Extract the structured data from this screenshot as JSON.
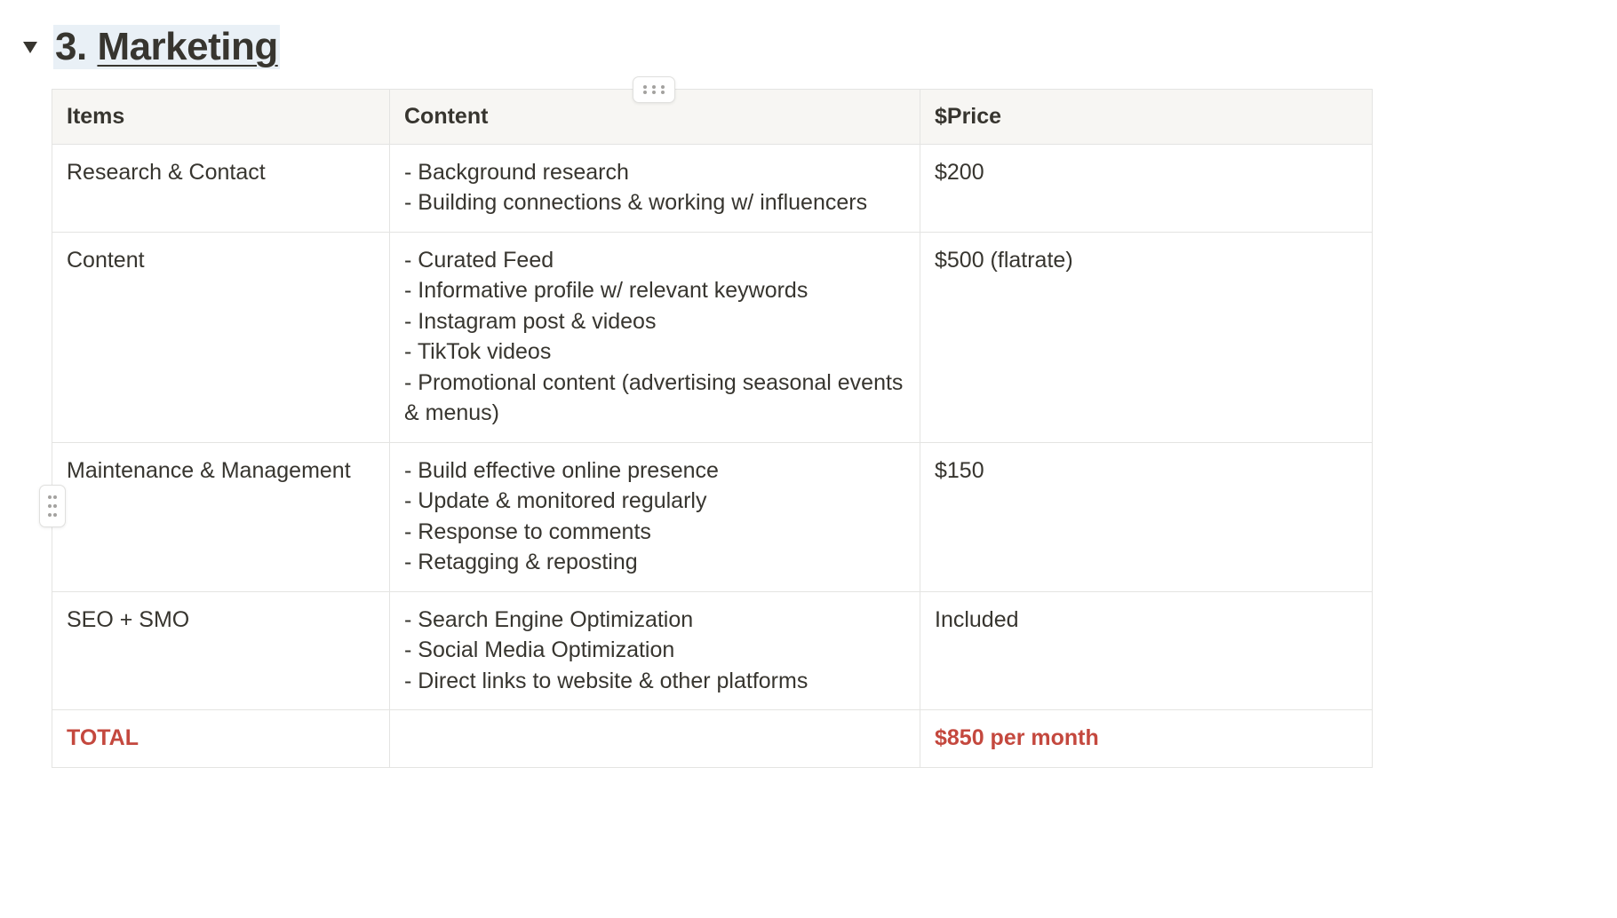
{
  "heading": {
    "number": "3.",
    "title": "Marketing"
  },
  "icons": {
    "toggle": "triangle-down-icon",
    "column_handle": "drag-dots-horizontal-icon",
    "row_handle": "drag-dots-vertical-icon"
  },
  "colors": {
    "text": "#37352f",
    "header_bg": "#f7f6f3",
    "total": "#c4483e",
    "heading_highlight": "#e9f0f6"
  },
  "table": {
    "headers": [
      "Items",
      "Content",
      "$Price"
    ],
    "rows": [
      {
        "item": "Research & Contact",
        "content": [
          "- Background research",
          "- Building connections & working w/ influencers"
        ],
        "price": "$200"
      },
      {
        "item": "Content",
        "content": [
          "- Curated Feed",
          "- Informative profile w/ relevant keywords",
          "- Instagram post & videos",
          "- TikTok videos",
          "- Promotional content (advertising seasonal events & menus)"
        ],
        "price": "$500 (flatrate)"
      },
      {
        "item": "Maintenance & Management",
        "content": [
          "- Build effective online presence",
          "- Update & monitored regularly",
          "- Response to comments",
          "- Retagging & reposting"
        ],
        "price": "$150"
      },
      {
        "item": "SEO + SMO",
        "content": [
          "- Search Engine Optimization",
          "- Social Media Optimization",
          "- Direct links to website & other platforms"
        ],
        "price": "Included"
      }
    ],
    "total": {
      "label": "TOTAL",
      "content": "",
      "price": "$850 per month"
    }
  }
}
